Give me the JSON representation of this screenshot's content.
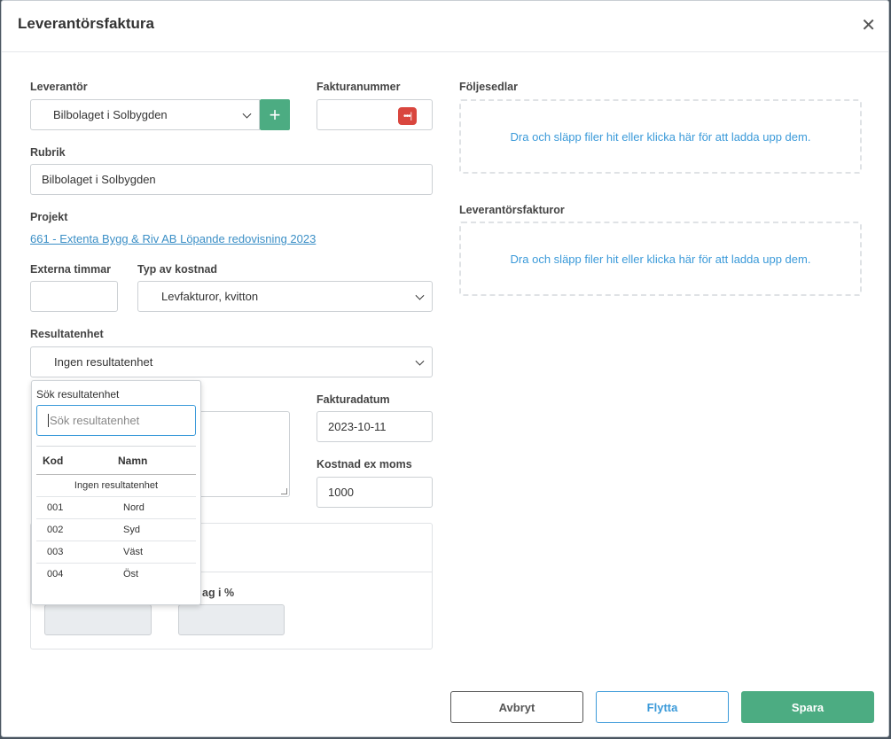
{
  "modal": {
    "title": "Leverantörsfaktura"
  },
  "form": {
    "supplier_label": "Leverantör",
    "supplier_value": "Bilbolaget i Solbygden",
    "invoice_number_label": "Fakturanummer",
    "invoice_number_value": "",
    "heading_label": "Rubrik",
    "heading_value": "Bilbolaget i Solbygden",
    "project_label": "Projekt",
    "project_link": "661 - Extenta Bygg & Riv AB Löpande redovisning 2023",
    "external_hours_label": "Externa timmar",
    "external_hours_value": "",
    "cost_type_label": "Typ av kostnad",
    "cost_type_value": "Levfakturor, kvitton",
    "result_unit_label": "Resultatenhet",
    "result_unit_value": "Ingen resultatenhet",
    "invoice_date_label": "Fakturadatum",
    "invoice_date_value": "2023-10-11",
    "cost_ex_vat_label": "Kostnad ex moms",
    "cost_ex_vat_value": "1000",
    "percent_label_partial": "ag i %"
  },
  "uploads": {
    "delivery_notes_label": "Följesedlar",
    "delivery_notes_drop": "Dra och släpp filer hit eller klicka här för att ladda upp dem.",
    "supplier_invoices_label": "Leverantörsfakturor",
    "supplier_invoices_drop": "Dra och släpp filer hit eller klicka här för att ladda upp dem."
  },
  "dropdown": {
    "search_label": "Sök resultatenhet",
    "search_placeholder": "Sök resultatenhet",
    "col_code": "Kod",
    "col_name": "Namn",
    "none_option": "Ingen resultatenhet",
    "rows": [
      {
        "code": "001",
        "name": "Nord"
      },
      {
        "code": "002",
        "name": "Syd"
      },
      {
        "code": "003",
        "name": "Väst"
      },
      {
        "code": "004",
        "name": "Öst"
      }
    ]
  },
  "buttons": {
    "cancel": "Avbryt",
    "move": "Flytta",
    "save": "Spara"
  },
  "icons": {
    "close": "close-icon",
    "add": "plus-icon",
    "password": "password-manager-icon",
    "chevron": "chevron-down-icon"
  },
  "colors": {
    "primary_green": "#4cac82",
    "link_blue": "#3b9ad9",
    "password_red": "#d9463e"
  }
}
